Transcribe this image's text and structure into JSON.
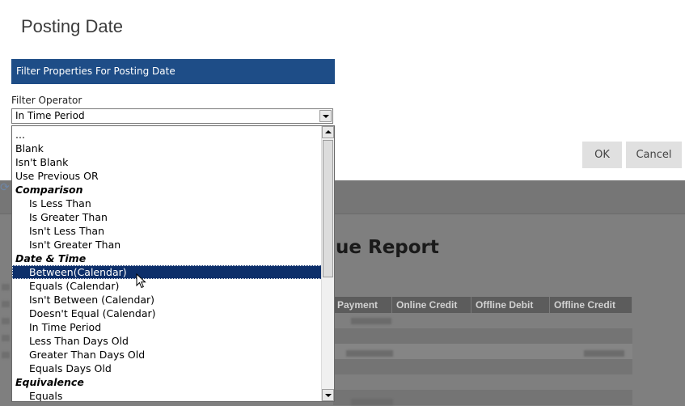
{
  "dialog": {
    "title": "Posting Date",
    "section_header": "Filter Properties For Posting Date",
    "field_label": "Filter Operator",
    "selected_value": "In Time Period",
    "options": [
      {
        "label": "...",
        "type": "item"
      },
      {
        "label": "Blank",
        "type": "item"
      },
      {
        "label": "Isn't Blank",
        "type": "item"
      },
      {
        "label": "Use Previous OR",
        "type": "item"
      },
      {
        "label": "Comparison",
        "type": "group"
      },
      {
        "label": "Is Less Than",
        "type": "sub"
      },
      {
        "label": "Is Greater Than",
        "type": "sub"
      },
      {
        "label": "Isn't Less Than",
        "type": "sub"
      },
      {
        "label": "Isn't Greater Than",
        "type": "sub"
      },
      {
        "label": "Date & Time",
        "type": "group"
      },
      {
        "label": "Between(Calendar)",
        "type": "sub",
        "highlighted": true
      },
      {
        "label": "Equals (Calendar)",
        "type": "sub"
      },
      {
        "label": "Isn't Between (Calendar)",
        "type": "sub"
      },
      {
        "label": "Doesn't Equal (Calendar)",
        "type": "sub"
      },
      {
        "label": "In Time Period",
        "type": "sub"
      },
      {
        "label": "Less Than Days Old",
        "type": "sub"
      },
      {
        "label": "Greater Than Days Old",
        "type": "sub"
      },
      {
        "label": "Equals Days Old",
        "type": "sub"
      },
      {
        "label": "Equivalence",
        "type": "group"
      },
      {
        "label": "Equals",
        "type": "sub"
      }
    ],
    "ok_label": "OK",
    "cancel_label": "Cancel"
  },
  "background_report": {
    "title_fragment": "ue Report",
    "columns": [
      "Payment",
      "Online Credit",
      "Offline Debit",
      "Offline Credit"
    ]
  },
  "colors": {
    "header_blue": "#1e4d87",
    "selection_navy": "#0d2f6a",
    "overlay_gray": "#7f7f7f"
  },
  "icons": {
    "refresh": "refresh-icon",
    "dropdown": "chevron-down-icon",
    "cursor": "mouse-pointer-icon"
  }
}
